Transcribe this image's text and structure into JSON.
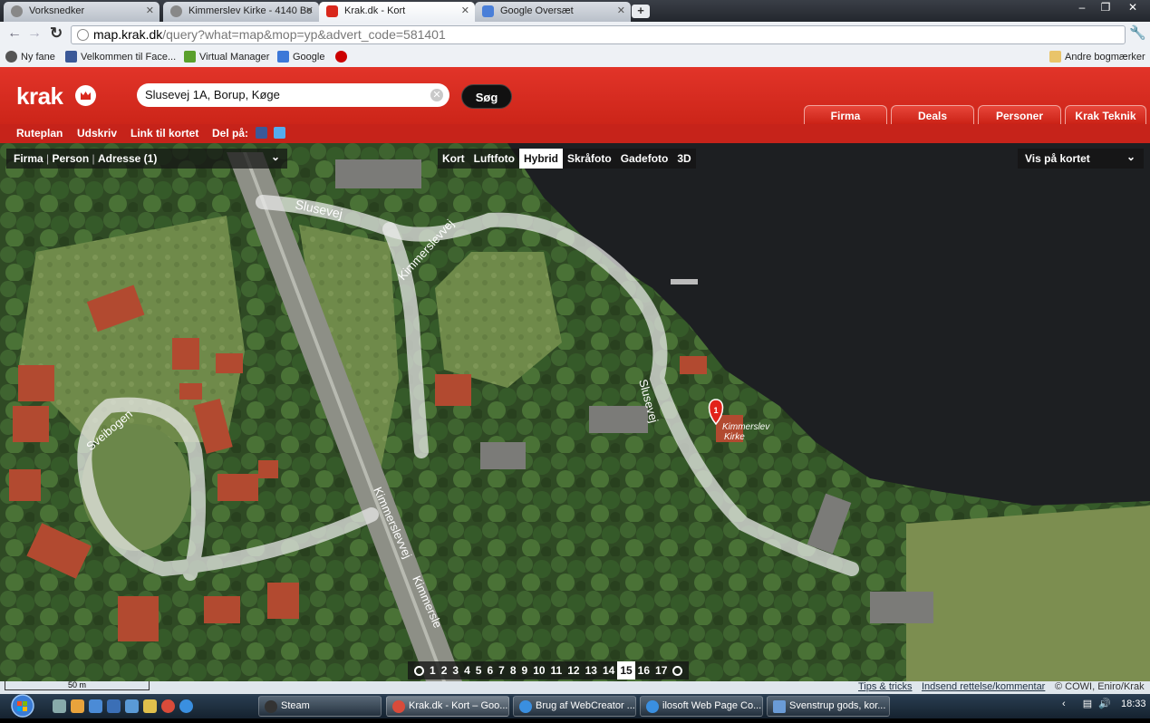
{
  "browser": {
    "tabs": [
      {
        "label": "Vorksnedker",
        "active": false
      },
      {
        "label": "Kimmerslev Kirke - 4140 Bo",
        "active": false
      },
      {
        "label": "Krak.dk - Kort",
        "active": true
      },
      {
        "label": "Google Oversæt",
        "active": false
      }
    ],
    "new_tab": "+",
    "url_host": "map.krak.dk",
    "url_path": "/query?what=map&mop=yp&advert_code=581401",
    "bookmarks": [
      "Ny fane",
      "Velkommen til Face...",
      "Virtual Manager",
      "Google"
    ],
    "other_bookmarks": "Andre bogmærker"
  },
  "krak": {
    "logo": "krak",
    "search_value": "Slusevej 1A, Borup, Køge",
    "search_button": "Søg",
    "main_tabs": [
      "Firma",
      "Deals",
      "Personer",
      "Krak Teknik"
    ],
    "subnav": [
      "Ruteplan",
      "Udskriv",
      "Link til kortet",
      "Del på:"
    ]
  },
  "map": {
    "search_panel": {
      "firma": "Firma",
      "person": "Person",
      "adresse": "Adresse (1)"
    },
    "modes": [
      "Kort",
      "Luftfoto",
      "Hybrid",
      "Skråfoto",
      "Gadefoto",
      "3D"
    ],
    "selected_mode": "Hybrid",
    "vis_paa_kortet": "Vis på kortet",
    "road_labels": {
      "slusevej": "Slusevej",
      "kimmerslevvej": "Kimmerslevvej",
      "sveibogen": "Sveibogen",
      "kimmerslev_short": "Kimmersle"
    },
    "marker": {
      "number": "1",
      "label_line1": "Kimmerslev",
      "label_line2": "Kirke"
    },
    "zoom_levels": [
      "1",
      "2",
      "3",
      "4",
      "5",
      "6",
      "7",
      "8",
      "9",
      "10",
      "11",
      "12",
      "13",
      "14",
      "15",
      "16",
      "17"
    ],
    "selected_zoom": "15",
    "scale": "50 m",
    "footer_links": [
      "Tips & tricks",
      "Indsend rettelse/kommentar"
    ],
    "copyright": "© COWI, Eniro/Krak"
  },
  "taskbar": {
    "tasks": [
      "Steam",
      "Krak.dk - Kort – Goo...",
      "Brug af WebCreator ...",
      "ilosoft Web Page Co...",
      "Svenstrup gods, kor..."
    ],
    "time": "18:33"
  }
}
